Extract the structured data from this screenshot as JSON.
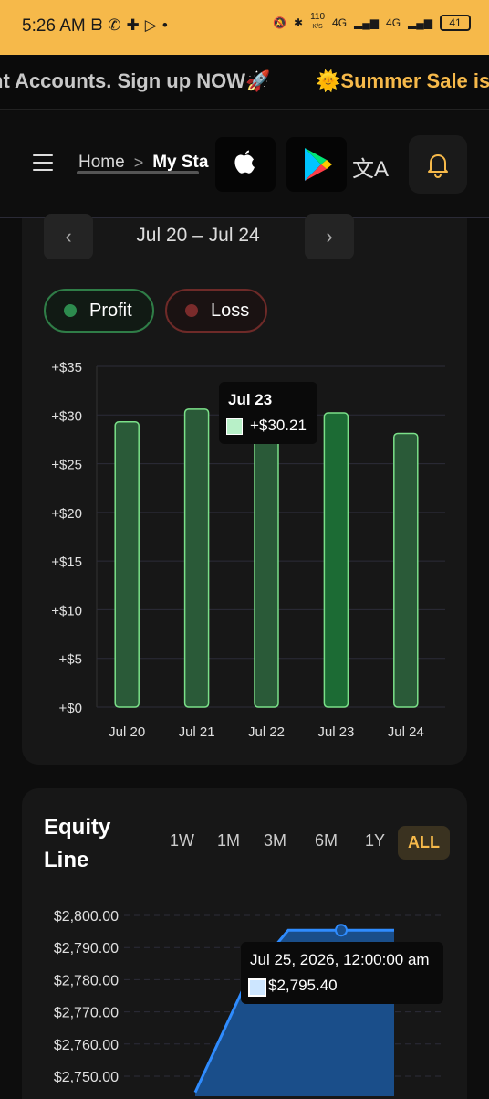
{
  "status": {
    "time": "5:26 AM",
    "icons_left": [
      "b-app-icon",
      "whatsapp-icon",
      "puzzle-icon",
      "play-outline-icon",
      "dot"
    ],
    "net_speed": "110",
    "net_unit": "K/S",
    "net1": "4G",
    "net2": "4G",
    "battery": "41"
  },
  "ticker": {
    "text1": "nt Accounts. Sign up NOW🚀",
    "text2": "🌞Summer Sale is"
  },
  "nav": {
    "home": "Home",
    "separator": ">",
    "current": "My Sta"
  },
  "daily": {
    "range": "Jul 20 – Jul 24",
    "profit_label": "Profit",
    "loss_label": "Loss",
    "colors": {
      "profit": "#2d8b4e",
      "loss": "#7a2b2b",
      "bar_fill": "#2a5a38",
      "bar_active": "#1c6b34",
      "bar_stroke": "#7be089"
    },
    "tooltip": {
      "date": "Jul 23",
      "value": "+$30.21"
    }
  },
  "equity": {
    "title_line1": "Equity",
    "title_line2": "Line",
    "ranges": [
      "1W",
      "1M",
      "3M",
      "6M",
      "1Y",
      "ALL"
    ],
    "active_range": "ALL",
    "tooltip": {
      "date": "Jul 25, 2026, 12:00:00 am",
      "value": "$2,795.40"
    }
  },
  "chart_data": [
    {
      "type": "bar",
      "categories": [
        "Jul 20",
        "Jul 21",
        "Jul 22",
        "Jul 23",
        "Jul 24"
      ],
      "values": [
        29.3,
        30.6,
        29.5,
        30.21,
        28.1
      ],
      "ylim": [
        0,
        35
      ],
      "yticks": [
        "+$0",
        "+$5",
        "+$10",
        "+$15",
        "+$20",
        "+$25",
        "+$30",
        "+$35"
      ],
      "highlighted": "Jul 23",
      "grid": true
    },
    {
      "type": "area",
      "x": [
        "",
        "",
        "Jul 25, 2026",
        ""
      ],
      "values": [
        2745,
        2780.5,
        2795.4,
        2795.4
      ],
      "ylim": [
        2745,
        2800
      ],
      "yticks": [
        "$2,750.00",
        "$2,760.00",
        "$2,770.00",
        "$2,780.00",
        "$2,790.00",
        "$2,800.00"
      ],
      "grid": true
    }
  ]
}
